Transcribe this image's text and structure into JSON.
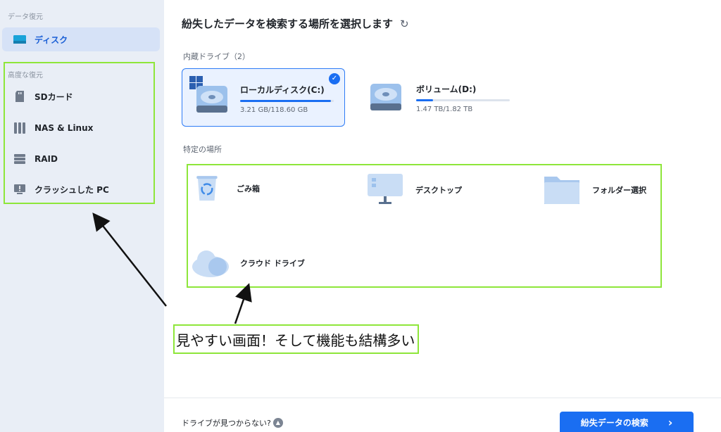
{
  "sidebar": {
    "section_data_recovery": "データ復元",
    "disk_label": "ディスク",
    "section_advanced": "高度な復元",
    "items": [
      {
        "label": "SDカード",
        "icon": "sd-card-icon"
      },
      {
        "label": "NAS & Linux",
        "icon": "nas-icon"
      },
      {
        "label": "RAID",
        "icon": "raid-icon"
      },
      {
        "label": "クラッシュした PC",
        "icon": "crashed-pc-icon"
      }
    ]
  },
  "main": {
    "title": "紛失したデータを検索する場所を選択します",
    "internal_drives_label": "内蔵ドライブ（2）",
    "drives": [
      {
        "name": "ローカルディスク(C:)",
        "size": "3.21 GB/118.60 GB",
        "usage": 0.97,
        "selected": true
      },
      {
        "name": "ボリューム(D:)",
        "size": "1.47 TB/1.82 TB",
        "usage": 0.18,
        "selected": false
      }
    ],
    "specific_locations_label": "特定の場所",
    "locations": [
      {
        "label": "ごみ箱",
        "icon": "recycle-bin-icon"
      },
      {
        "label": "デスクトップ",
        "icon": "desktop-icon"
      },
      {
        "label": "フォルダー選択",
        "icon": "folder-icon"
      },
      {
        "label": "クラウド ドライブ",
        "icon": "cloud-drive-icon"
      }
    ]
  },
  "footer": {
    "drive_not_found": "ドライブが見つからない?",
    "scan_button": "紛失データの検索",
    "scan_arrow": "›"
  },
  "annotation": {
    "text": "見やすい画面！そして機能も結構多い"
  },
  "colors": {
    "accent": "#1a6ef2",
    "annotation_green": "#8ee63a",
    "sidebar_bg": "#e9eef6"
  }
}
